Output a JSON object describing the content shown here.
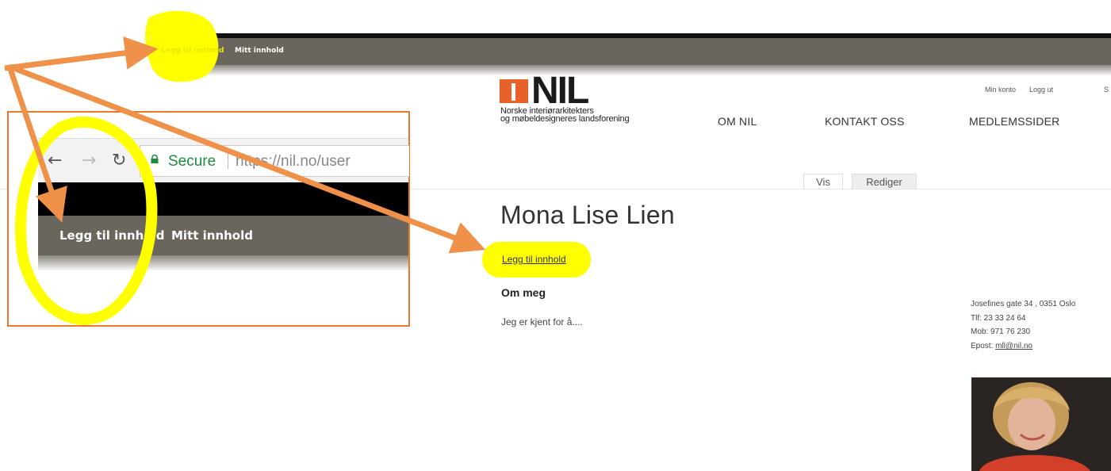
{
  "admin_toolbar": {
    "add_content": "Legg til innhold",
    "my_content": "Mitt innhold"
  },
  "header": {
    "logo_text": "NIL",
    "logo_subtitle_1": "Norske interiørarkitekters",
    "logo_subtitle_2": "og møbeldesigneres landsforening",
    "nav": [
      "OM NIL",
      "KONTAKT OSS",
      "MEDLEMSSIDER"
    ],
    "utility": {
      "account": "Min konto",
      "logout": "Logg ut",
      "extra": "S"
    }
  },
  "tabs": [
    "Vis",
    "Rediger"
  ],
  "profile": {
    "name": "Mona Lise Lien",
    "add_content_link": "Legg til innhold",
    "about_heading": "Om meg",
    "about_text": "Jeg er kjent for å....",
    "contact": {
      "address": "Josefines gate 34 , 0351 Oslo",
      "phone": "Tlf: 23 33 24 64",
      "mobile": "Mob: 971 76 230",
      "email_label": "Epost:",
      "email": "mll@nil.no"
    }
  },
  "inset_browser": {
    "secure_label": "Secure",
    "url_text": "https://nil.no/user",
    "toolbar": {
      "add_content": "Legg til innhold",
      "my_content": "Mitt innhold"
    }
  },
  "colors": {
    "annotation_arrow": "#f0914a",
    "highlight": "#ffff00",
    "toolbar": "#6b665d",
    "logo_accent": "#e9612a"
  }
}
